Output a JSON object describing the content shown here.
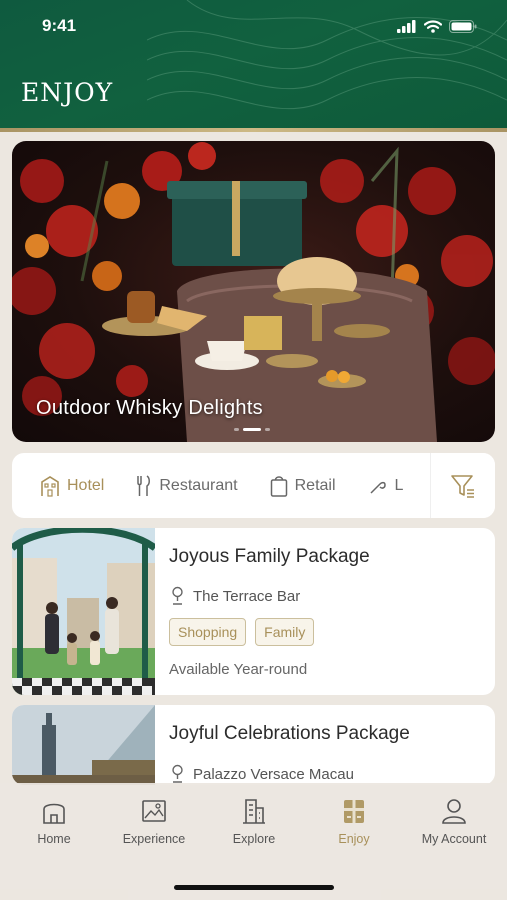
{
  "status_bar": {
    "time": "9:41"
  },
  "header": {
    "title": "ENJOY"
  },
  "hero": {
    "title": "Outdoor Whisky Delights",
    "slide_count": 3,
    "active_slide": 2
  },
  "categories": {
    "items": [
      {
        "label": "Hotel",
        "icon": "hotel-icon",
        "active": true
      },
      {
        "label": "Restaurant",
        "icon": "cutlery-icon",
        "active": false
      },
      {
        "label": "Retail",
        "icon": "shopping-bag-icon",
        "active": false
      },
      {
        "label": "L",
        "icon": "spa-icon",
        "active": false
      }
    ],
    "filter_icon": "filter-icon"
  },
  "cards": [
    {
      "title": "Joyous Family Package",
      "location": "The Terrace Bar",
      "tags": [
        "Shopping",
        "Family"
      ],
      "availability": "Available Year-round"
    },
    {
      "title": "Joyful Celebrations Package",
      "location": "Palazzo Versace Macau"
    }
  ],
  "tabbar": {
    "items": [
      {
        "label": "Home",
        "icon": "home-icon"
      },
      {
        "label": "Experience",
        "icon": "image-icon"
      },
      {
        "label": "Explore",
        "icon": "building-icon"
      },
      {
        "label": "Enjoy",
        "icon": "gift-icon",
        "active": true
      },
      {
        "label": "My Account",
        "icon": "user-icon"
      }
    ]
  },
  "colors": {
    "header_green": "#0f5a3f",
    "accent_gold": "#a8905a",
    "background": "#ece7e0"
  }
}
